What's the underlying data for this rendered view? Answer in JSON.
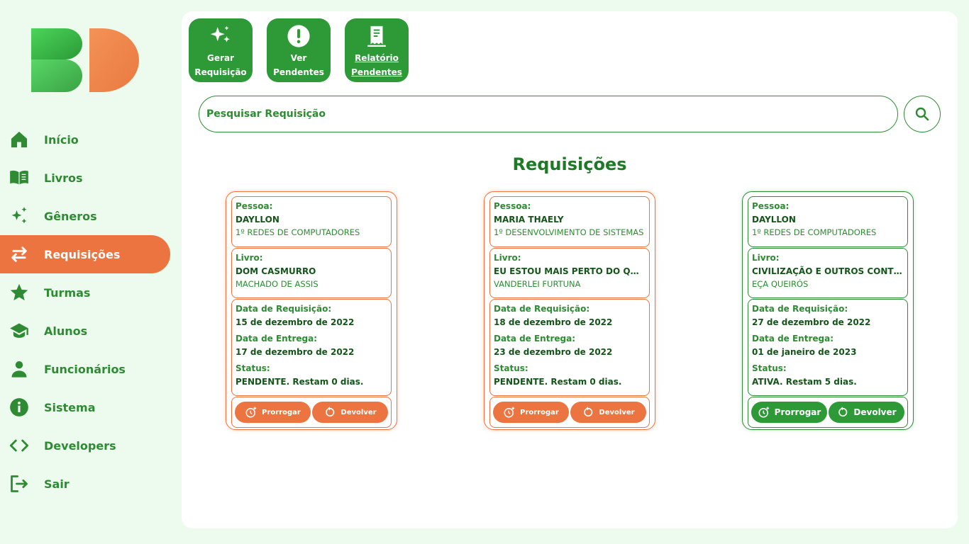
{
  "brand": {
    "logo_letters": "BD",
    "green": "#2e9a37",
    "orange": "#ec7440"
  },
  "sidebar": {
    "items": [
      {
        "label": "Início",
        "icon": "home-icon"
      },
      {
        "label": "Livros",
        "icon": "book-icon"
      },
      {
        "label": "Gêneros",
        "icon": "sparkles-icon"
      },
      {
        "label": "Requisições",
        "icon": "arrows-exchange-icon",
        "active": true
      },
      {
        "label": "Turmas",
        "icon": "star-icon"
      },
      {
        "label": "Alunos",
        "icon": "graduation-cap-icon"
      },
      {
        "label": "Funcionários",
        "icon": "person-icon"
      },
      {
        "label": "Sistema",
        "icon": "info-icon"
      },
      {
        "label": "Developers",
        "icon": "code-icon"
      },
      {
        "label": "Sair",
        "icon": "logout-icon"
      }
    ]
  },
  "actions": [
    {
      "label": "Gerar\nRequisição",
      "icon": "sparkles-icon"
    },
    {
      "label": "Ver\nPendentes",
      "icon": "alert-icon"
    },
    {
      "label": "Relatório\nPendentes",
      "icon": "receipt-icon"
    }
  ],
  "search": {
    "placeholder": "Pesquisar Requisição",
    "icon": "search-icon"
  },
  "page_title": "Requisições",
  "labels": {
    "pessoa": "Pessoa:",
    "livro": "Livro:",
    "data_requisicao": "Data de Requisição:",
    "data_entrega": "Data de Entrega:",
    "status": "Status:",
    "prorrogar": "Prorrogar",
    "devolver": "Devolver"
  },
  "requisicoes": [
    {
      "pessoa": "DAYLLON",
      "turma": "1º REDES DE COMPUTADORES",
      "livro": "DOM CASMURRO",
      "autor": "MACHADO DE ASSIS",
      "data_requisicao": "15 de dezembro de 2022",
      "data_entrega": "17 de dezembro de 2022",
      "status": "PENDENTE. Restam 0 dias.",
      "state": "pending"
    },
    {
      "pessoa": "MARIA THAELY",
      "turma": "1º DESENVOLVIMENTO DE SISTEMAS",
      "livro": "EU ESTOU MAIS PERTO DO QUE VOCÊ IMAGINA",
      "autor": "VANDERLEI FURTUNA",
      "data_requisicao": "18 de dezembro de 2022",
      "data_entrega": "23 de dezembro de 2022",
      "status": "PENDENTE. Restam 0 dias.",
      "state": "pending"
    },
    {
      "pessoa": "DAYLLON",
      "turma": "1º REDES DE COMPUTADORES",
      "livro": "CIVILIZAÇÃO E OUTROS CONTOS",
      "autor": "EÇA QUEIRÓS",
      "data_requisicao": "27 de dezembro de 2022",
      "data_entrega": "01 de janeiro de 2023",
      "status": "ATIVA. Restam 5 dias.",
      "state": "active"
    }
  ]
}
